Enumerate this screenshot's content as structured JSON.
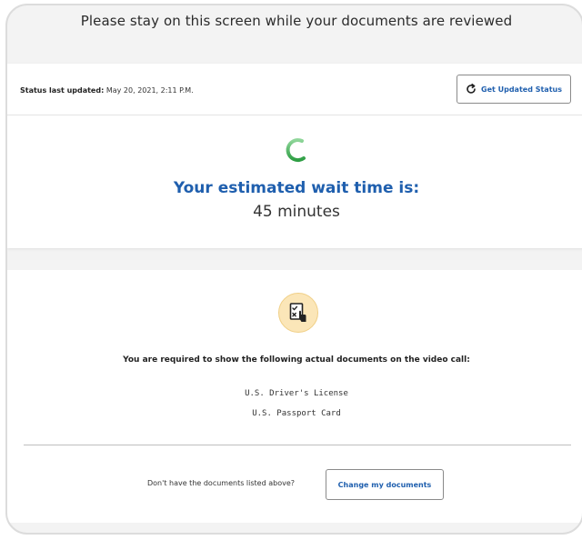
{
  "header": {
    "title": "Please stay on this screen while your documents are reviewed"
  },
  "status": {
    "label": "Status last updated:",
    "timestamp": "May 20, 2021, 2:11 P.M.",
    "update_button_label": "Get Updated Status"
  },
  "wait": {
    "title": "Your estimated wait time is:",
    "value": "45 minutes"
  },
  "documents": {
    "instruction": "You are required to show the following actual documents on the video call:",
    "items": [
      "U.S. Driver's License",
      "U.S. Passport Card"
    ],
    "missing_prompt": "Don't have the documents listed above?",
    "change_button_label": "Change my documents"
  },
  "icons": {
    "refresh": "refresh-icon",
    "spinner": "loading-spinner-icon",
    "document": "document-checklist-icon"
  },
  "colors": {
    "accent_blue": "#1f5fae",
    "spinner_green": "#3aa84a",
    "icon_badge": "#fbe6b8"
  }
}
